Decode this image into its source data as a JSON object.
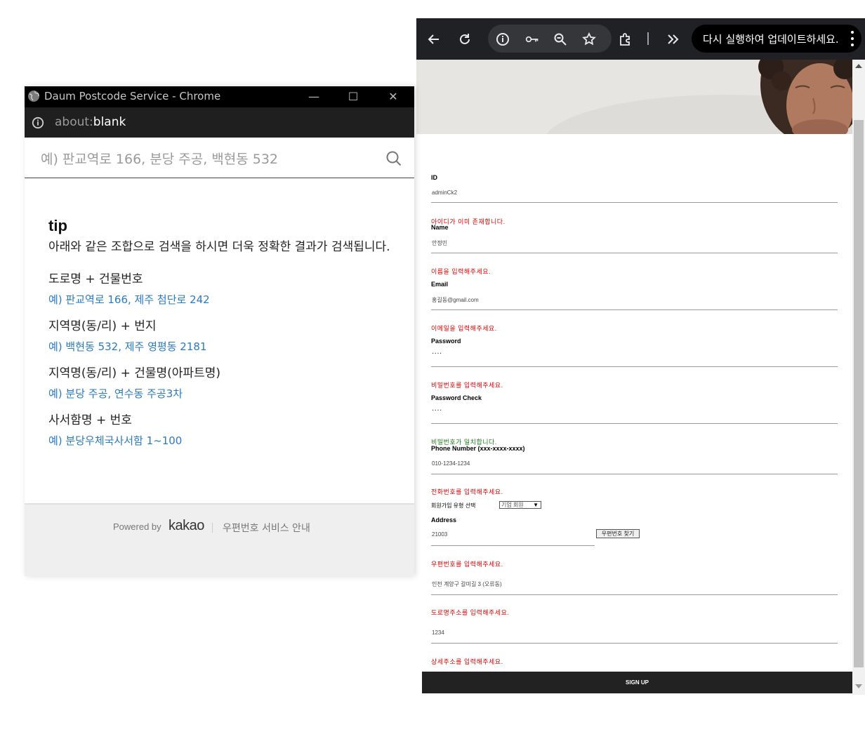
{
  "main_window": {
    "toolbar": {
      "update_message": "다시 실행하여 업데이트하세요."
    },
    "form": {
      "id": {
        "label": "ID",
        "value": "adminCk2",
        "message": "아이디가 이미 존재합니다."
      },
      "name": {
        "label": "Name",
        "value": "안정민",
        "message": "이름을 입력해주세요."
      },
      "email": {
        "label": "Email",
        "value": "홍길동@gmail.com",
        "message": "이메일을 입력해주세요."
      },
      "password": {
        "label": "Password",
        "value": "....",
        "message": "비밀번호를 입력해주세요."
      },
      "password_check": {
        "label": "Password Check",
        "value": "....",
        "message": "비밀번호가 일치합니다."
      },
      "phone": {
        "label": "Phone Number (xxx-xxxx-xxxx)",
        "value": "010-1234-1234",
        "message": "전화번호를 입력해주세요."
      },
      "member_type": {
        "label": "회원가입 유형 선택",
        "selected": "기업 회원"
      },
      "address": {
        "label": "Address",
        "zip_value": "21003",
        "zip_button": "우편번호 찾기",
        "zip_message": "우편번호를 입력해주세요.",
        "road_value": "인천 계양구 갈미길 3 (오류동)",
        "road_message": "도로명주소를 입력해주세요.",
        "detail_value": "1234",
        "detail_message": "상세주소를 입력해주세요."
      },
      "submit_label": "SIGN UP"
    }
  },
  "popup_window": {
    "title": "Daum Postcode Service - Chrome",
    "url_prefix": "about:",
    "url_host": "blank",
    "search_placeholder": "예) 판교역로 166, 분당 주공, 백현동 532",
    "tip": {
      "title": "tip",
      "description": "아래와 같은 조합으로 검색을 하시면 더욱 정확한 결과가 검색됩니다.",
      "items": [
        {
          "heading": "도로명 + 건물번호",
          "example": "예) 판교역로 166,  제주 첨단로 242"
        },
        {
          "heading": "지역명(동/리) + 번지",
          "example": "예) 백현동 532,  제주 영평동 2181"
        },
        {
          "heading": "지역명(동/리) + 건물명(아파트명)",
          "example": "예) 분당 주공,  연수동 주공3차"
        },
        {
          "heading": "사서함명 + 번호",
          "example": "예) 분당우체국사서함 1~100"
        }
      ]
    },
    "footer": {
      "powered_by": "Powered by",
      "brand": "kakao",
      "guide_link": "우편번호 서비스 안내"
    }
  },
  "colors": {
    "error": "#e00000",
    "success": "#1d7a1d",
    "link": "#2a7ac0"
  }
}
